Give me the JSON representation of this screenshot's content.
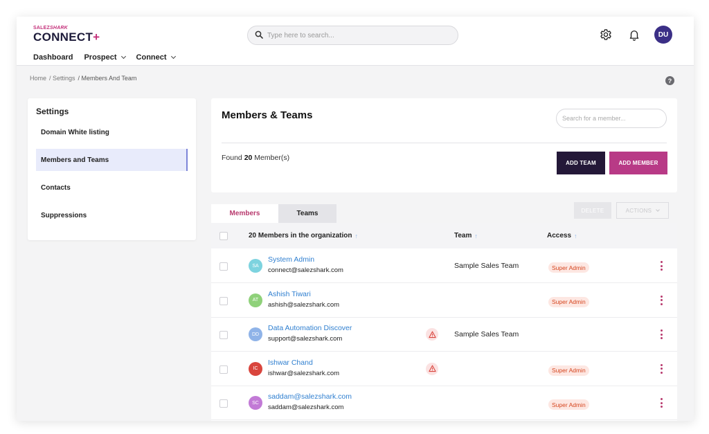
{
  "header": {
    "logo_small_prefix": "SALEZ",
    "logo_small_suffix": "SHARK",
    "logo_main": "CONNECT",
    "logo_plus": "+",
    "search_placeholder": "Type here to search...",
    "avatar_initials": "DU",
    "nav": [
      {
        "label": "Dashboard"
      },
      {
        "label": "Prospect"
      },
      {
        "label": "Connect"
      }
    ]
  },
  "breadcrumb": [
    "Home",
    "/ Settings",
    "/ Members And Team"
  ],
  "settings": {
    "title": "Settings",
    "items": [
      {
        "label": "Domain White listing"
      },
      {
        "label": "Members and Teams"
      },
      {
        "label": "Contacts"
      },
      {
        "label": "Suppressions"
      }
    ]
  },
  "main": {
    "title": "Members & Teams",
    "search_placeholder": "Search for a member...",
    "found_prefix": "Found ",
    "found_count": "20",
    "found_suffix": " Member(s)",
    "add_team": "ADD TEAM",
    "add_member": "ADD MEMBER"
  },
  "tabs": [
    {
      "label": "Members"
    },
    {
      "label": "Teams"
    }
  ],
  "toolbar": {
    "delete": "DELETE",
    "actions": "ACTIONS"
  },
  "table": {
    "headers": {
      "members": "20 Members in the organization",
      "team": "Team",
      "access": "Access"
    },
    "rows": [
      {
        "initials": "SA",
        "avatar_color": "#7dd3df",
        "name": "System Admin",
        "email": "connect@salezshark.com",
        "team": "Sample Sales Team",
        "access": "Super Admin",
        "warning": false
      },
      {
        "initials": "AT",
        "avatar_color": "#8fd17a",
        "name": "Ashish Tiwari",
        "email": "ashish@salezshark.com",
        "team": "",
        "access": "Super Admin",
        "warning": false
      },
      {
        "initials": "DD",
        "avatar_color": "#8fb3e8",
        "name": "Data Automation Discover",
        "email": "support@salezshark.com",
        "team": "Sample Sales Team",
        "access": "",
        "warning": true
      },
      {
        "initials": "IC",
        "avatar_color": "#d9453d",
        "name": "Ishwar Chand",
        "email": "ishwar@salezshark.com",
        "team": "",
        "access": "Super Admin",
        "warning": true
      },
      {
        "initials": "SC",
        "avatar_color": "#c27ad6",
        "name": "saddam@salezshark.com",
        "email": "saddam@salezshark.com",
        "team": "",
        "access": "Super Admin",
        "warning": false
      }
    ]
  },
  "icons": {
    "search": "search-icon",
    "settings": "gear-icon",
    "notifications": "bell-icon",
    "help": "help-icon",
    "warning": "warning-icon",
    "row_menu": "kebab-menu-icon"
  },
  "colors": {
    "brand_pink": "#b83a86",
    "brand_dark": "#241838",
    "link_blue": "#2f7fd0",
    "badge_text": "#d5451e",
    "badge_bg": "#fde7e2"
  }
}
